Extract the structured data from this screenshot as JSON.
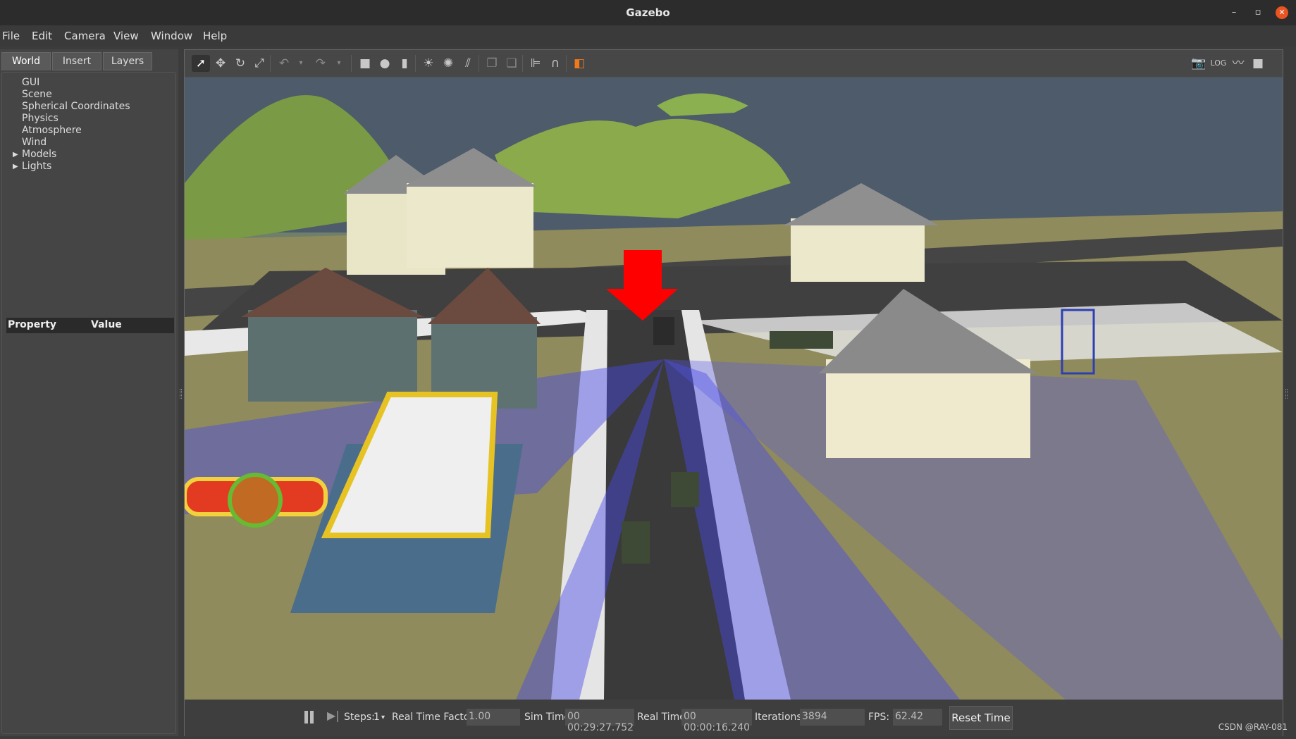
{
  "window": {
    "title": "Gazebo",
    "controls": [
      "–",
      "▫",
      "✕"
    ]
  },
  "menu": {
    "items": [
      "File",
      "Edit",
      "Camera",
      "View",
      "Window",
      "Help"
    ]
  },
  "left_panel": {
    "tabs": [
      "World",
      "Insert",
      "Layers"
    ],
    "active_tab": "World",
    "tree": [
      {
        "label": "GUI",
        "expandable": false
      },
      {
        "label": "Scene",
        "expandable": false
      },
      {
        "label": "Spherical Coordinates",
        "expandable": false
      },
      {
        "label": "Physics",
        "expandable": false
      },
      {
        "label": "Atmosphere",
        "expandable": false
      },
      {
        "label": "Wind",
        "expandable": false
      },
      {
        "label": "Models",
        "expandable": true
      },
      {
        "label": "Lights",
        "expandable": true
      }
    ],
    "property_table": {
      "col1": "Property",
      "col2": "Value"
    }
  },
  "toolbar": {
    "left_tools": [
      "select-arrow-icon",
      "translate-icon",
      "rotate-icon",
      "scale-icon",
      "undo-icon",
      "undo-dropdown-icon",
      "redo-icon",
      "redo-dropdown-icon",
      "box-icon",
      "sphere-icon",
      "cylinder-icon",
      "point-light-icon",
      "spot-light-icon",
      "directional-light-icon",
      "copy-icon",
      "paste-icon",
      "align-icon",
      "snap-icon",
      "view-angle-icon"
    ],
    "right_tools": [
      "screenshot-icon",
      "log-icon",
      "plot-icon",
      "video-record-icon"
    ]
  },
  "bottom_bar": {
    "steps_label": "Steps:",
    "steps_value": "1",
    "rtf_label": "Real Time Factor:",
    "rtf_value": "1.00",
    "sim_time_label": "Sim Time:",
    "sim_time_value": "00 00:29:27.752",
    "real_time_label": "Real Time:",
    "real_time_value": "00 00:00:16.240",
    "iterations_label": "Iterations:",
    "iterations_value": "3894",
    "fps_label": "FPS:",
    "fps_value": "62.42",
    "reset_label": "Reset Time"
  },
  "watermark": "CSDN @RAY-081",
  "colors": {
    "sea": "#4d5b6b",
    "grass": "#8f8b5c",
    "road": "#3a3a3a",
    "laser": "#4a4ae8",
    "arrow": "#ff0000"
  }
}
